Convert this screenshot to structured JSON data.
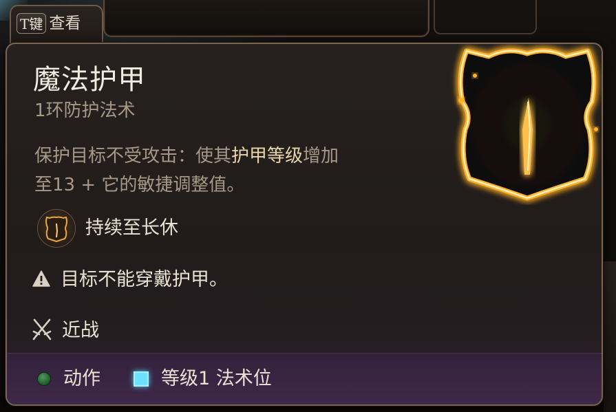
{
  "key_hint": {
    "key": "T键",
    "label": "查看"
  },
  "spell": {
    "name": "魔法护甲",
    "level_school": "1环防护法术",
    "description_line1_pre": "保护目标不受攻击：使其",
    "description_line1_highlight": "护甲等级",
    "description_line1_post": "增加",
    "description_line2": "至13 + 它的敏捷调整值。",
    "icon": "glowing-armor-icon"
  },
  "properties": {
    "duration": {
      "icon": "armor-duration-icon",
      "text": "持续至长休"
    },
    "requirement": {
      "icon": "warning-icon",
      "text": "目标不能穿戴护甲。"
    },
    "range": {
      "icon": "crossed-swords-icon",
      "text": "近战"
    }
  },
  "costs": [
    {
      "icon": "action-dot-icon",
      "label": "动作",
      "color": "#2f7a3a"
    },
    {
      "icon": "spell-slot-icon",
      "label": "等级1 法术位",
      "color": "#6ce0ff"
    }
  ],
  "colors": {
    "title": "#f4ece0",
    "muted": "#a89886",
    "highlight": "#e8d6a8",
    "glow": "#ffb02a",
    "footer": "#3a2544"
  }
}
